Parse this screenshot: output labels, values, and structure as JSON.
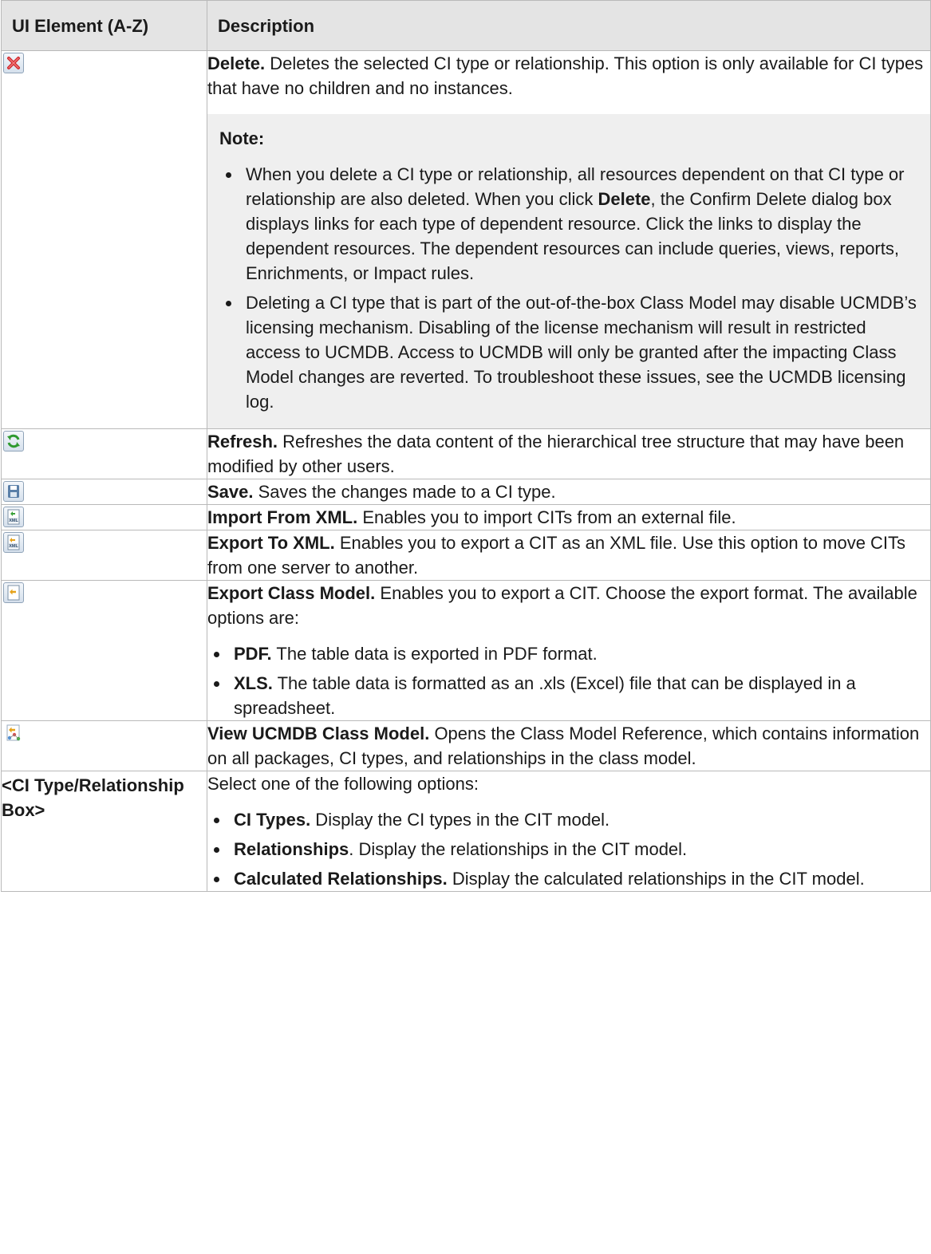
{
  "table": {
    "col_element": "UI Element (A-Z)",
    "col_description": "Description"
  },
  "rows": {
    "delete": {
      "icon": "delete-icon",
      "title": "Delete.",
      "text": " Deletes the selected CI type or relationship. This option is only available for CI types that have no children and no instances.",
      "note_title": "Note:",
      "note_1_a": "When you delete a CI type or relationship, all resources dependent on that CI type or relationship are also deleted. When you click ",
      "note_1_bold": "Delete",
      "note_1_b": ", the Confirm Delete dialog box displays links for each type of dependent resource. Click the links to display the dependent resources. The dependent resources can include queries, views, reports, Enrichments, or Impact rules.",
      "note_2": "Deleting a CI type that is part of the out-of-the-box Class Model may disable UCMDB’s licensing mechanism. Disabling of the license mechanism will result in restricted access to UCMDB. Access to UCMDB will only be granted after the impacting Class Model changes are reverted. To troubleshoot these issues, see the UCMDB licensing log."
    },
    "refresh": {
      "icon": "refresh-icon",
      "title": "Refresh.",
      "text": " Refreshes the data content of the hierarchical tree structure that may have been modified by other users."
    },
    "save": {
      "icon": "save-icon",
      "title": "Save.",
      "text": " Saves the changes made to a CI type."
    },
    "import_xml": {
      "icon": "import-xml-icon",
      "title": "Import From XML.",
      "text": " Enables you to import CITs from an external file."
    },
    "export_xml": {
      "icon": "export-xml-icon",
      "title": "Export To XML.",
      "text": " Enables you to export a CIT as an XML file. Use this option to move CITs from one server to another."
    },
    "export_class_model": {
      "icon": "export-icon",
      "title": "Export Class Model.",
      "text": " Enables you to export a CIT. Choose the export format. The available options are:",
      "opt_pdf_bold": "PDF.",
      "opt_pdf_text": " The table data is exported in PDF format.",
      "opt_xls_bold": "XLS.",
      "opt_xls_text": " The table data is formatted as an .xls (Excel) file that can be displayed in a spreadsheet."
    },
    "view_class_model": {
      "icon": "class-model-icon",
      "title": "View UCMDB Class Model.",
      "text": " Opens the Class Model Reference, which contains information on all packages, CI types, and relationships in the class model."
    },
    "ci_type_box": {
      "element": "<CI Type/Relationship Box>",
      "intro": "Select one of the following options:",
      "opt_ci_bold": "CI Types.",
      "opt_ci_text": " Display the CI types in the CIT model.",
      "opt_rel_bold": "Relationships",
      "opt_rel_text": ". Display the relationships in the CIT model.",
      "opt_calc_bold": "Calculated Relationships.",
      "opt_calc_text": " Display the calculated relationships in the CIT model."
    }
  }
}
